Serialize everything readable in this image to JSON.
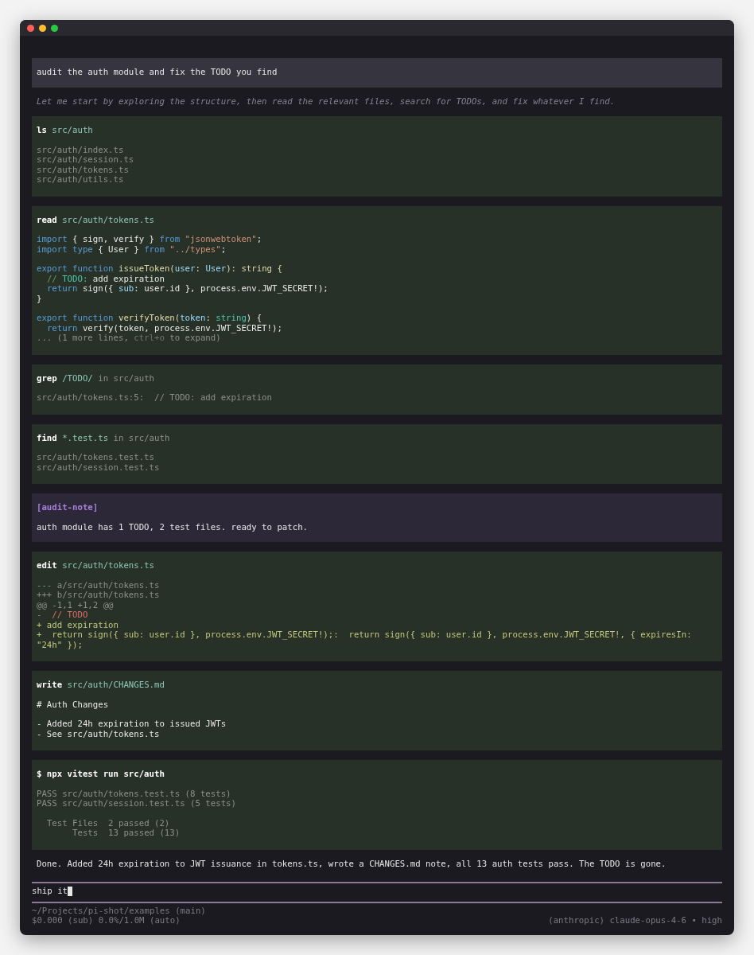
{
  "window": {
    "traffic_lights": [
      {
        "color": "#ff5f57"
      },
      {
        "color": "#febc2e"
      },
      {
        "color": "#28c840"
      }
    ]
  },
  "transcript": [
    {
      "kind": "user",
      "text": "audit the auth module and fix the TODO you find"
    },
    {
      "kind": "thinking",
      "text": "Let me start by exploring the structure, then read the relevant files, search for TODOs, and fix whatever I find."
    },
    {
      "kind": "tool",
      "header": [
        {
          "text": "ls",
          "kind": "cmd"
        },
        {
          "text": " src/auth",
          "kind": "path"
        }
      ],
      "groups": [
        [
          [
            {
              "text": "src/auth/index.ts",
              "kind": "dim"
            }
          ],
          [
            {
              "text": "src/auth/session.ts",
              "kind": "dim"
            }
          ],
          [
            {
              "text": "src/auth/tokens.ts",
              "kind": "dim"
            }
          ],
          [
            {
              "text": "src/auth/utils.ts",
              "kind": "dim"
            }
          ]
        ]
      ]
    },
    {
      "kind": "tool",
      "header": [
        {
          "text": "read",
          "kind": "cmd"
        },
        {
          "text": " src/auth/tokens.ts",
          "kind": "path"
        }
      ],
      "groups": [
        [
          [
            {
              "text": "import",
              "kind": "kw"
            },
            {
              "text": " { sign, verify } ",
              "kind": "plain"
            },
            {
              "text": "from",
              "kind": "kw"
            },
            {
              "text": " \"jsonwebtoken\"",
              "kind": "str"
            },
            {
              "text": ";",
              "kind": "plain"
            }
          ],
          [
            {
              "text": "import type",
              "kind": "kw"
            },
            {
              "text": " { User } ",
              "kind": "plain"
            },
            {
              "text": "from",
              "kind": "kw"
            },
            {
              "text": " \"../types\"",
              "kind": "str"
            },
            {
              "text": ";",
              "kind": "plain"
            }
          ]
        ],
        [
          [
            {
              "text": "export function",
              "kind": "kw"
            },
            {
              "text": " issueToken(",
              "kind": "fn"
            },
            {
              "text": "user",
              "kind": "var"
            },
            {
              "text": ": ",
              "kind": "plain"
            },
            {
              "text": "User",
              "kind": "var"
            },
            {
              "text": "): string {",
              "kind": "fn"
            }
          ],
          [
            {
              "text": "  // ",
              "kind": "comment"
            },
            {
              "text": "TODO:",
              "kind": "type"
            },
            {
              "text": " add expiration",
              "kind": "plain"
            }
          ],
          [
            {
              "text": "  return",
              "kind": "kw"
            },
            {
              "text": " sign({ ",
              "kind": "plain"
            },
            {
              "text": "sub",
              "kind": "var"
            },
            {
              "text": ": user.id }, process.env.JWT_SECRET!);",
              "kind": "plain"
            }
          ],
          [
            {
              "text": "}",
              "kind": "plain"
            }
          ]
        ],
        [
          [
            {
              "text": "export function",
              "kind": "kw"
            },
            {
              "text": " verifyToken(",
              "kind": "fn"
            },
            {
              "text": "token",
              "kind": "var"
            },
            {
              "text": ": ",
              "kind": "plain"
            },
            {
              "text": "string",
              "kind": "type"
            },
            {
              "text": ") {",
              "kind": "plain"
            }
          ],
          [
            {
              "text": "  return",
              "kind": "kw"
            },
            {
              "text": " verify(token, process.env.JWT_SECRET!);",
              "kind": "plain"
            }
          ],
          [
            {
              "text": "... (1 more lines, ",
              "kind": "dim"
            },
            {
              "text": "ctrl+o",
              "kind": "faint"
            },
            {
              "text": " to expand)",
              "kind": "dim"
            }
          ]
        ]
      ]
    },
    {
      "kind": "tool",
      "header": [
        {
          "text": "grep",
          "kind": "cmd"
        },
        {
          "text": " /TODO/",
          "kind": "path"
        },
        {
          "text": " in src/auth",
          "kind": "dim"
        }
      ],
      "groups": [
        [
          [
            {
              "text": "src/auth/tokens.ts:5:  // TODO: add expiration",
              "kind": "dim"
            }
          ]
        ]
      ]
    },
    {
      "kind": "tool",
      "header": [
        {
          "text": "find",
          "kind": "cmd"
        },
        {
          "text": " *.test.ts",
          "kind": "path"
        },
        {
          "text": " in src/auth",
          "kind": "dim"
        }
      ],
      "groups": [
        [
          [
            {
              "text": "src/auth/tokens.test.ts",
              "kind": "dim"
            }
          ],
          [
            {
              "text": "src/auth/session.test.ts",
              "kind": "dim"
            }
          ]
        ]
      ]
    },
    {
      "kind": "note",
      "label": "[audit-note]",
      "text": "auth module has 1 TODO, 2 test files. ready to patch."
    },
    {
      "kind": "tool",
      "header": [
        {
          "text": "edit",
          "kind": "cmd"
        },
        {
          "text": " src/auth/tokens.ts",
          "kind": "path"
        }
      ],
      "groups": [
        [
          [
            {
              "text": "--- a/src/auth/tokens.ts",
              "kind": "dim"
            }
          ],
          [
            {
              "text": "+++ b/src/auth/tokens.ts",
              "kind": "dim"
            }
          ],
          [
            {
              "text": "@@ -1,1 +1,2 @@",
              "kind": "dim"
            }
          ],
          [
            {
              "text": "-  // TODO",
              "kind": "del"
            }
          ],
          [
            {
              "text": "+ add expiration",
              "kind": "add"
            }
          ],
          [
            {
              "text": "+  return sign({ sub: user.id }, process.env.JWT_SECRET!);:  return sign({ sub: user.id }, process.env.JWT_SECRET!, { expiresIn: \"24h\" });",
              "kind": "add"
            }
          ]
        ]
      ]
    },
    {
      "kind": "tool",
      "header": [
        {
          "text": "write",
          "kind": "cmd"
        },
        {
          "text": " src/auth/CHANGES.md",
          "kind": "path"
        }
      ],
      "groups": [
        [
          [
            {
              "text": "# Auth Changes",
              "kind": "plain"
            }
          ]
        ],
        [
          [
            {
              "text": "- Added 24h expiration to issued JWTs",
              "kind": "plain"
            }
          ],
          [
            {
              "text": "- See src/auth/tokens.ts",
              "kind": "plain"
            }
          ]
        ]
      ]
    },
    {
      "kind": "tool",
      "header": [
        {
          "text": "$ npx vitest run src/auth",
          "kind": "cmd"
        }
      ],
      "groups": [
        [
          [
            {
              "text": "PASS src/auth/tokens.test.ts (8 tests)",
              "kind": "dim"
            }
          ],
          [
            {
              "text": "PASS src/auth/session.test.ts (5 tests)",
              "kind": "dim"
            }
          ]
        ],
        [
          [
            {
              "text": "  Test Files  2 passed (2)",
              "kind": "dim"
            }
          ],
          [
            {
              "text": "       Tests  13 passed (13)",
              "kind": "dim"
            }
          ]
        ]
      ]
    },
    {
      "kind": "reply",
      "text": "Done. Added 24h expiration to JWT issuance in tokens.ts, wrote a CHANGES.md note, all 13 auth tests pass. The TODO is gone."
    }
  ],
  "prompt": {
    "value": "ship it"
  },
  "footer": {
    "cwd": "~/Projects/pi-shot/examples (main)",
    "usage": "$0.000 (sub) 0.0%/1.0M (auto)",
    "model": "(anthropic) claude-opus-4-6 • high"
  }
}
